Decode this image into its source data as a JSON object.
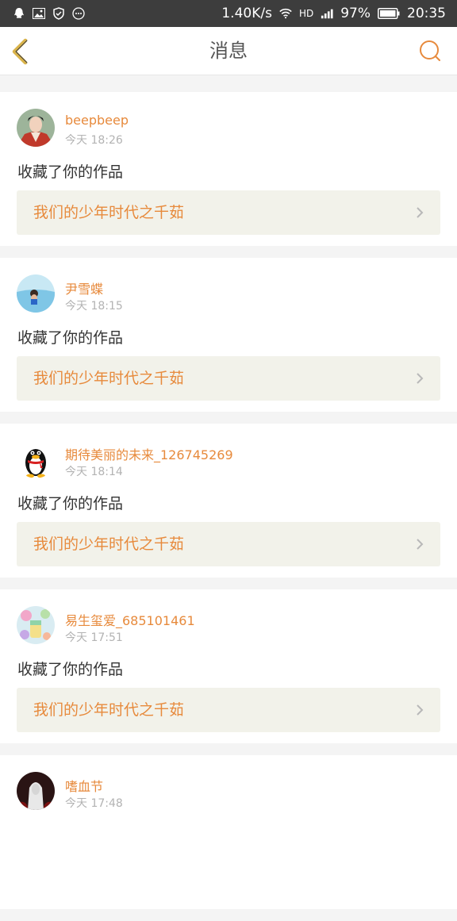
{
  "statusbar": {
    "speed": "1.40K/s",
    "battery": "97%",
    "time": "20:35",
    "net_label": "HD"
  },
  "header": {
    "title": "消息"
  },
  "colors": {
    "accent": "#e78a3c",
    "back_arrow": "#d9b34a",
    "link_bg": "#f2f2ea"
  },
  "messages": [
    {
      "username": "beepbeep",
      "time": "今天 18:26",
      "action": "收藏了你的作品",
      "work_title": "我们的少年时代之千茹",
      "avatar": "avatar-man-red"
    },
    {
      "username": "尹雪蝶",
      "time": "今天 18:15",
      "action": "收藏了你的作品",
      "work_title": "我们的少年时代之千茹",
      "avatar": "avatar-swimmer"
    },
    {
      "username": "期待美丽的未来_126745269",
      "time": "今天 18:14",
      "action": "收藏了你的作品",
      "work_title": "我们的少年时代之千茹",
      "avatar": "avatar-penguin"
    },
    {
      "username": "易生玺爱_685101461",
      "time": "今天 17:51",
      "action": "收藏了你的作品",
      "work_title": "我们的少年时代之千茹",
      "avatar": "avatar-drink"
    },
    {
      "username": "嗜血节",
      "time": "今天 17:48",
      "action": "",
      "work_title": "",
      "avatar": "avatar-dark"
    }
  ]
}
